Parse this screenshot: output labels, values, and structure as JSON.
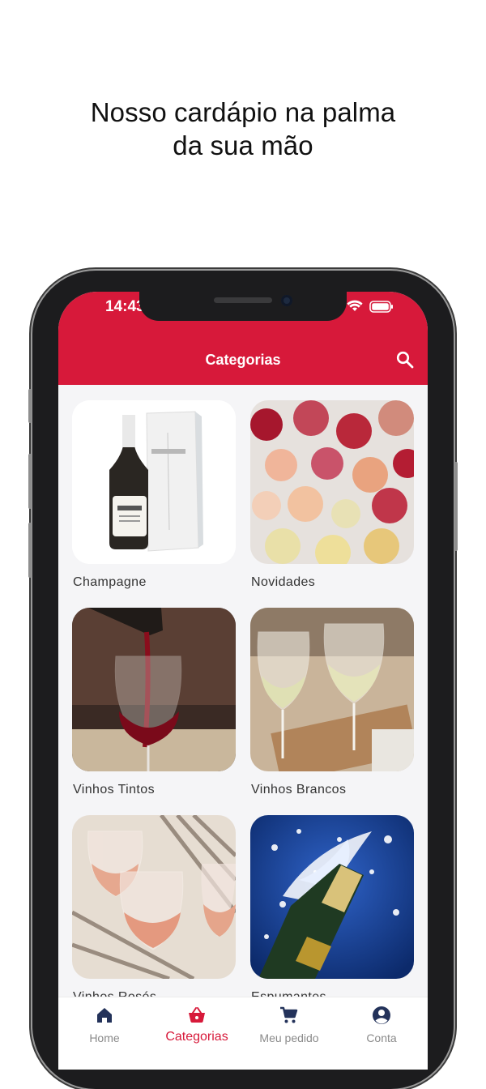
{
  "headline": {
    "line1": "Nosso cardápio na palma",
    "line2": "da sua mão"
  },
  "status": {
    "time": "14:43"
  },
  "appbar": {
    "title": "Categorias"
  },
  "categories": [
    {
      "label": "Champagne"
    },
    {
      "label": "Novidades"
    },
    {
      "label": "Vinhos Tintos"
    },
    {
      "label": "Vinhos Brancos"
    },
    {
      "label": "Vinhos Rosés"
    },
    {
      "label": "Espumantes"
    }
  ],
  "tabbar": {
    "items": [
      {
        "label": "Home",
        "icon": "home-icon"
      },
      {
        "label": "Categorias",
        "icon": "basket-icon"
      },
      {
        "label": "Meu pedido",
        "icon": "cart-icon"
      },
      {
        "label": "Conta",
        "icon": "account-icon"
      }
    ],
    "active_color": "#d7193a",
    "inactive_color": "#8a8a8a"
  },
  "colors": {
    "brand": "#d7193a"
  }
}
